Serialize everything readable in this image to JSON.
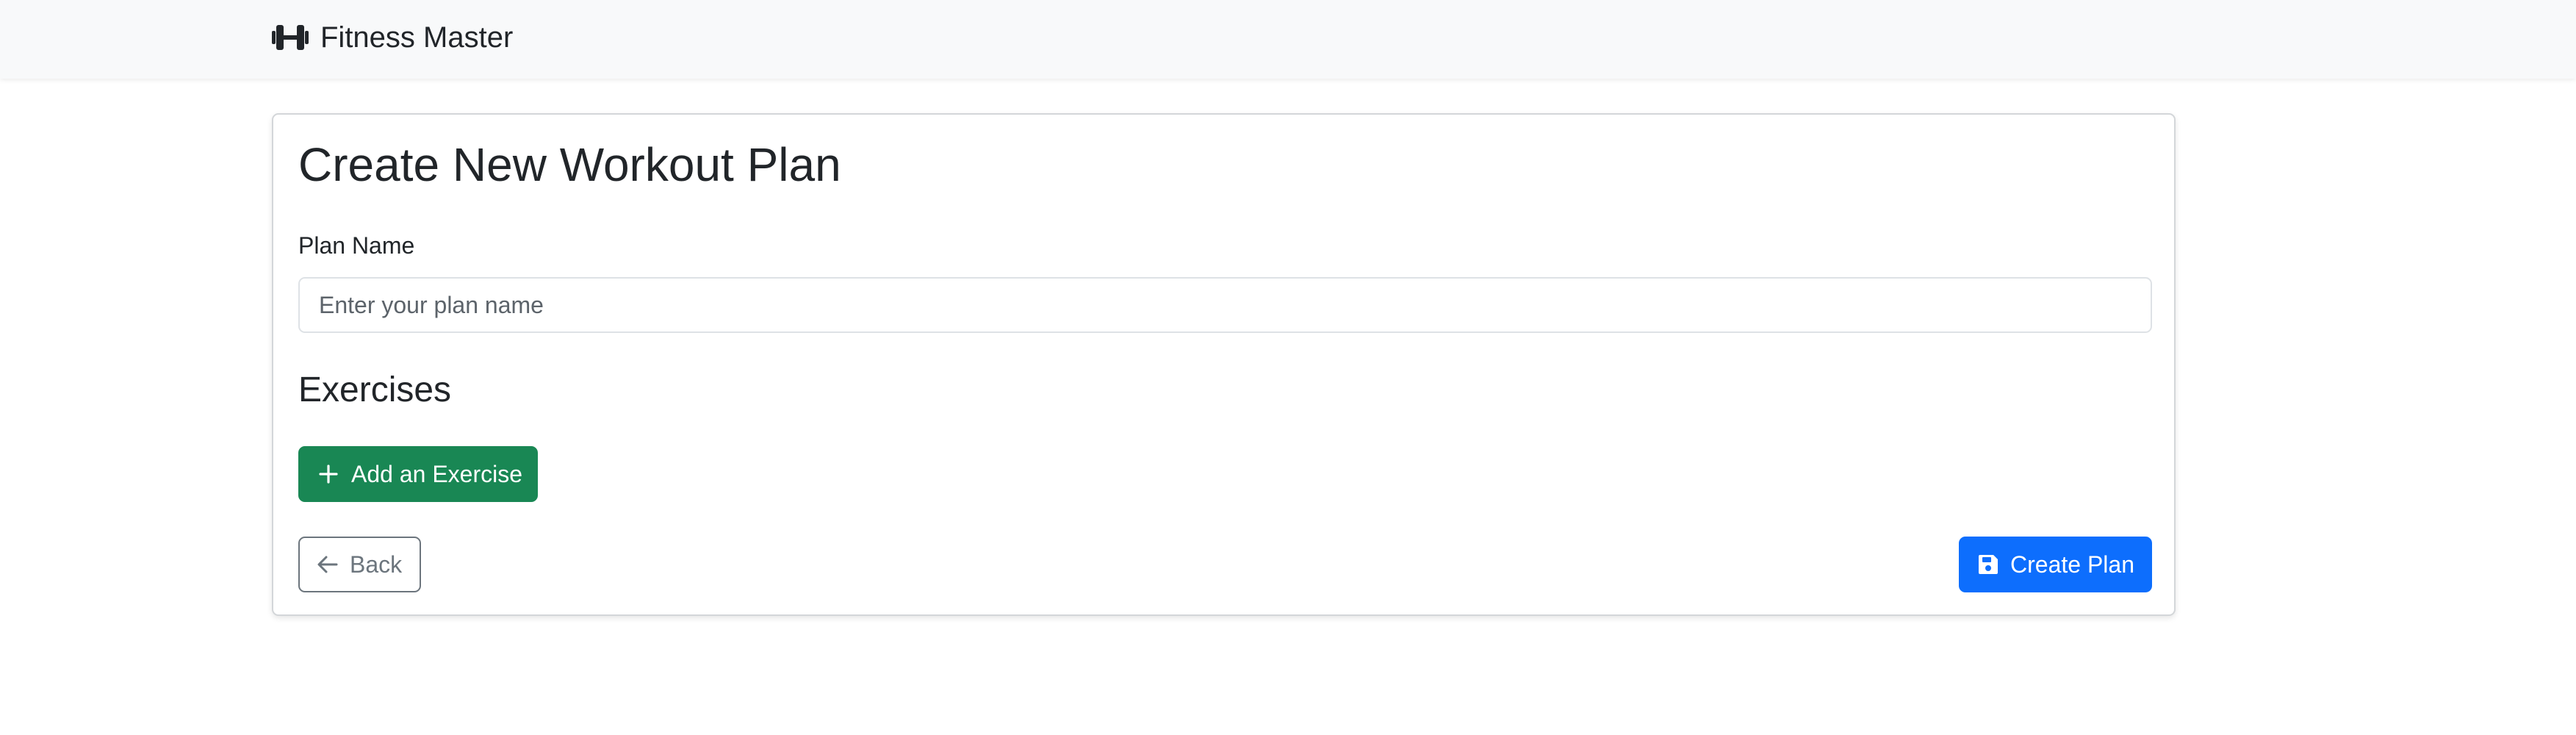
{
  "navbar": {
    "brand_icon": "dumbbell-icon",
    "brand_text": "Fitness Master"
  },
  "form": {
    "title": "Create New Workout Plan",
    "plan_name_label": "Plan Name",
    "plan_name_value": "",
    "plan_name_placeholder": "Enter your plan name",
    "exercises_heading": "Exercises",
    "add_exercise_label": "Add an Exercise",
    "add_exercise_icon": "plus-icon",
    "back_label": "Back",
    "back_icon": "arrow-left-icon",
    "create_label": "Create Plan",
    "create_icon": "save-icon"
  },
  "colors": {
    "navbar_bg": "#f8f9fa",
    "success": "#198754",
    "primary": "#0d6efd",
    "secondary": "#6c757d",
    "text": "#212529"
  }
}
